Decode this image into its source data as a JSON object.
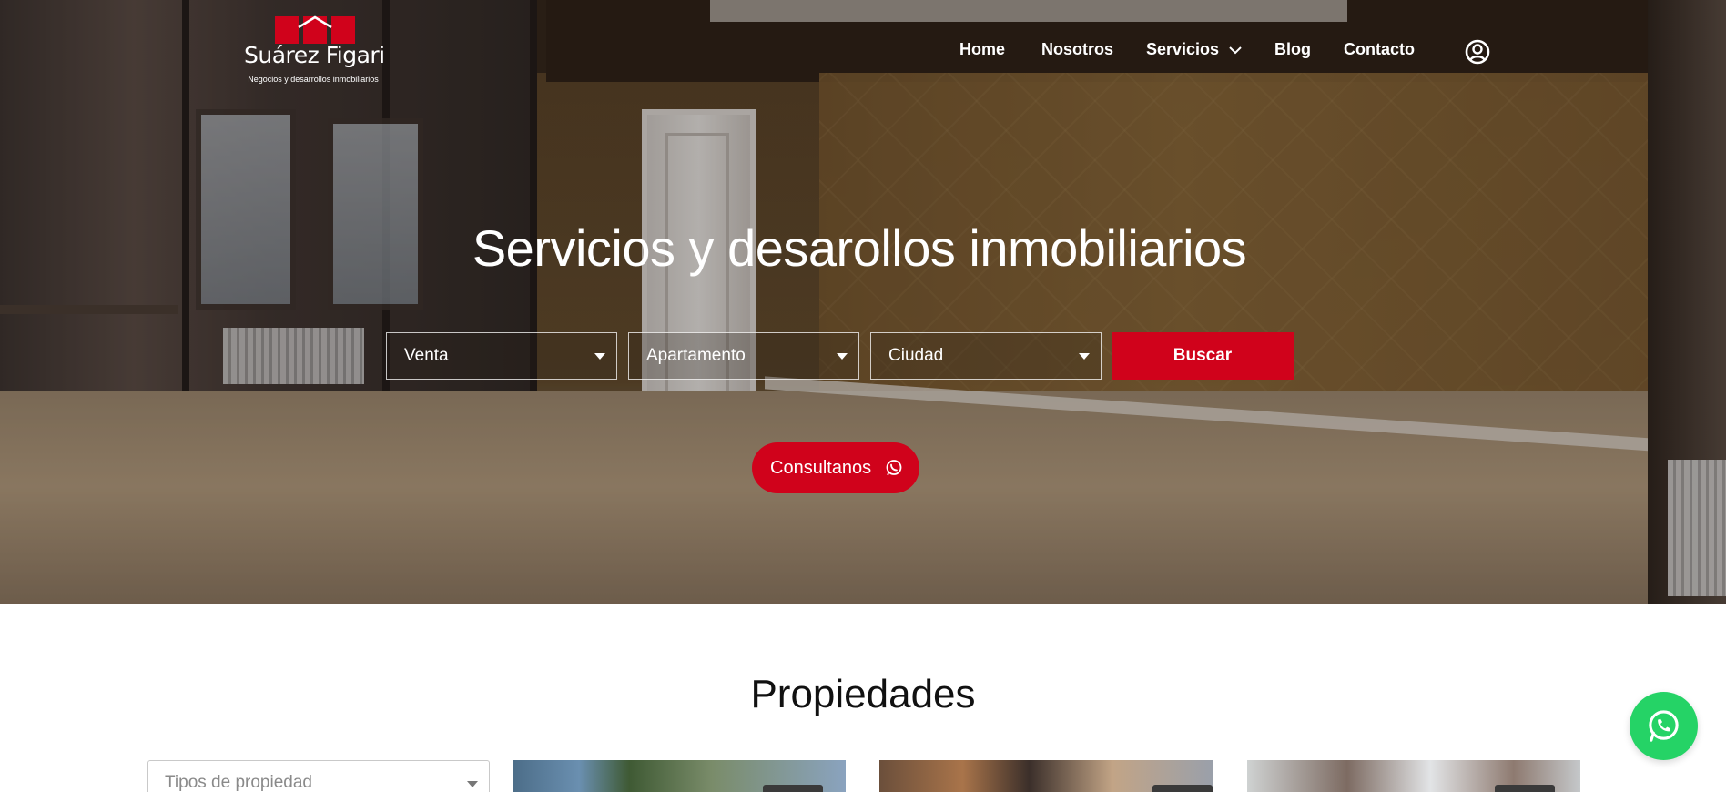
{
  "brand": {
    "name": "Suárez Figari",
    "tagline": "Negocios y desarrollos inmobiliarios",
    "accent_color": "#d0021b"
  },
  "nav": {
    "items": [
      {
        "label": "Home"
      },
      {
        "label": "Nosotros"
      },
      {
        "label": "Servicios",
        "has_dropdown": true
      },
      {
        "label": "Blog"
      },
      {
        "label": "Contacto"
      }
    ],
    "user_icon": "user-circle-icon"
  },
  "hero": {
    "title": "Servicios y desarollos inmobiliarios",
    "search": {
      "operation": "Venta",
      "property_type": "Apartamento",
      "city": "Ciudad",
      "button": "Buscar"
    },
    "cta": {
      "label": "Consultanos",
      "icon": "whatsapp-icon"
    }
  },
  "properties": {
    "title": "Propiedades",
    "filter_placeholder": "Tipos de propiedad"
  },
  "floating_button": {
    "icon": "whatsapp-icon",
    "color": "#25d366"
  }
}
